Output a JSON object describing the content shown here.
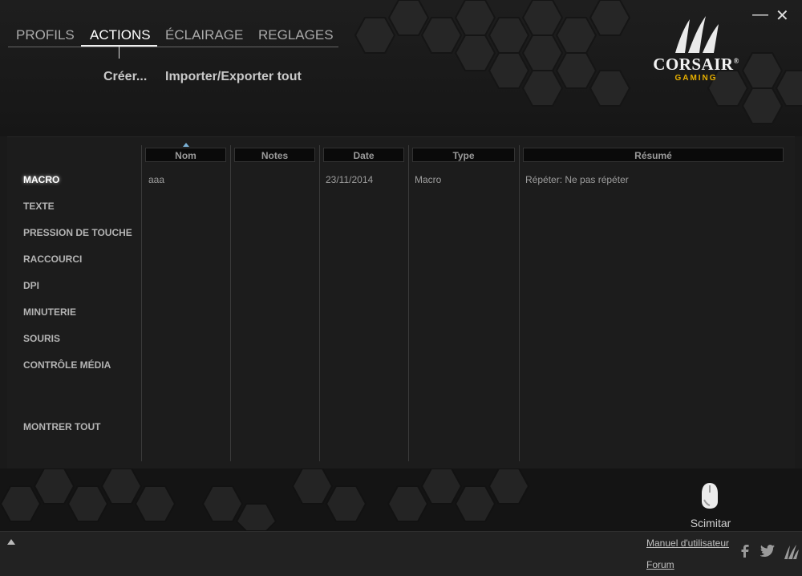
{
  "window": {
    "minimize_glyph": "—",
    "close_glyph": "✕"
  },
  "tabs": [
    {
      "label": "PROFILS",
      "active": false
    },
    {
      "label": "ACTIONS",
      "active": true
    },
    {
      "label": "ÉCLAIRAGE",
      "active": false
    },
    {
      "label": "REGLAGES",
      "active": false
    }
  ],
  "subactions": {
    "create": "Créer...",
    "import_export": "Importer/Exporter tout"
  },
  "logo": {
    "brand": "CORSAIR",
    "brand_mark": "®",
    "sub": "GAMING",
    "brand_color": "#e8b000"
  },
  "sidebar": {
    "items": [
      {
        "label": "MACRO",
        "active": true
      },
      {
        "label": "TEXTE"
      },
      {
        "label": "PRESSION DE TOUCHE"
      },
      {
        "label": "RACCOURCI"
      },
      {
        "label": "DPI"
      },
      {
        "label": "MINUTERIE"
      },
      {
        "label": "SOURIS"
      },
      {
        "label": "CONTRÔLE MÉDIA"
      }
    ],
    "show_all": "MONTRER TOUT"
  },
  "table": {
    "columns": [
      "Nom",
      "Notes",
      "Date",
      "Type",
      "Résumé"
    ],
    "sorted_column": "Nom",
    "rows": [
      {
        "name": "aaa",
        "notes": "",
        "date": "23/11/2014",
        "type": "Macro",
        "summary": "Répéter: Ne pas répéter"
      }
    ]
  },
  "device": {
    "name": "Scimitar",
    "icon": "mouse-icon"
  },
  "footer": {
    "manual_link": "Manuel d'utilisateur",
    "forum_link": "Forum",
    "social": [
      "facebook-icon",
      "twitter-icon",
      "corsair-icon"
    ]
  },
  "colors": {
    "accent": "#e8b000",
    "sort_indicator": "#7ab0d6",
    "background": "#1a1a1a"
  }
}
